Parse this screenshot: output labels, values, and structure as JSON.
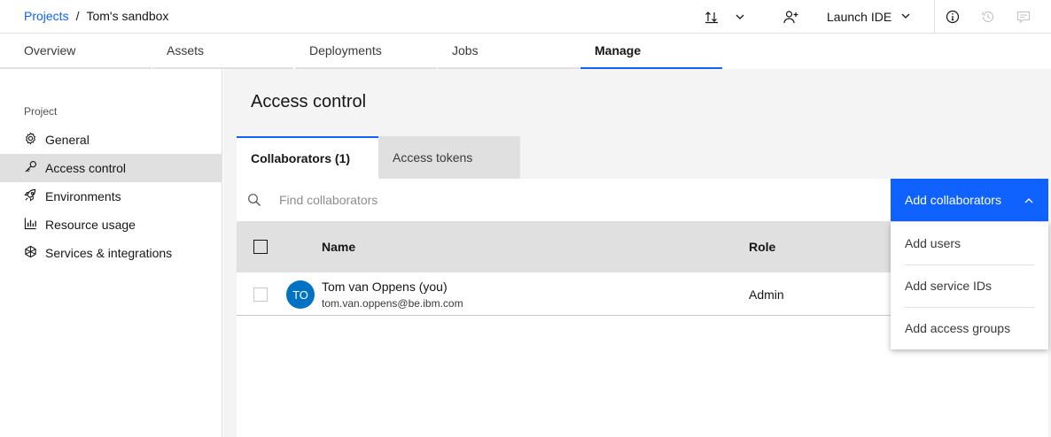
{
  "header": {
    "breadcrumb": {
      "parent": "Projects",
      "separator": "/",
      "current": "Tom's sandbox"
    },
    "launch_ide_label": "Launch IDE",
    "icons": [
      "upload-download-icon",
      "chevron-down-icon",
      "add-user-icon",
      "information-icon",
      "history-icon",
      "chat-icon"
    ]
  },
  "tabs": [
    {
      "label": "Overview"
    },
    {
      "label": "Assets"
    },
    {
      "label": "Deployments"
    },
    {
      "label": "Jobs"
    },
    {
      "label": "Manage",
      "active": true
    }
  ],
  "sidebar": {
    "heading": "Project",
    "items": [
      {
        "label": "General",
        "icon": "gear-icon"
      },
      {
        "label": "Access control",
        "icon": "key-icon",
        "active": true
      },
      {
        "label": "Environments",
        "icon": "rocket-icon"
      },
      {
        "label": "Resource usage",
        "icon": "bar-chart-icon"
      },
      {
        "label": "Services & integrations",
        "icon": "integrations-icon"
      }
    ]
  },
  "main": {
    "title": "Access control",
    "content_tabs": [
      {
        "label": "Collaborators (1)",
        "active": true
      },
      {
        "label": "Access tokens"
      }
    ],
    "search": {
      "placeholder": "Find collaborators",
      "value": ""
    },
    "add_button_label": "Add collaborators",
    "table": {
      "headers": {
        "name": "Name",
        "role": "Role"
      },
      "rows": [
        {
          "initials": "TO",
          "name": "Tom van Oppens (you)",
          "email": "tom.van.oppens@be.ibm.com",
          "role": "Admin"
        }
      ]
    },
    "add_menu": [
      {
        "label": "Add users"
      },
      {
        "label": "Add service IDs"
      },
      {
        "label": "Add access groups"
      }
    ]
  },
  "colors": {
    "accent": "#0f62fe",
    "avatar": "#0072c3",
    "sidebar_active": "#e0e0e0",
    "content_bg": "#f4f4f4"
  }
}
